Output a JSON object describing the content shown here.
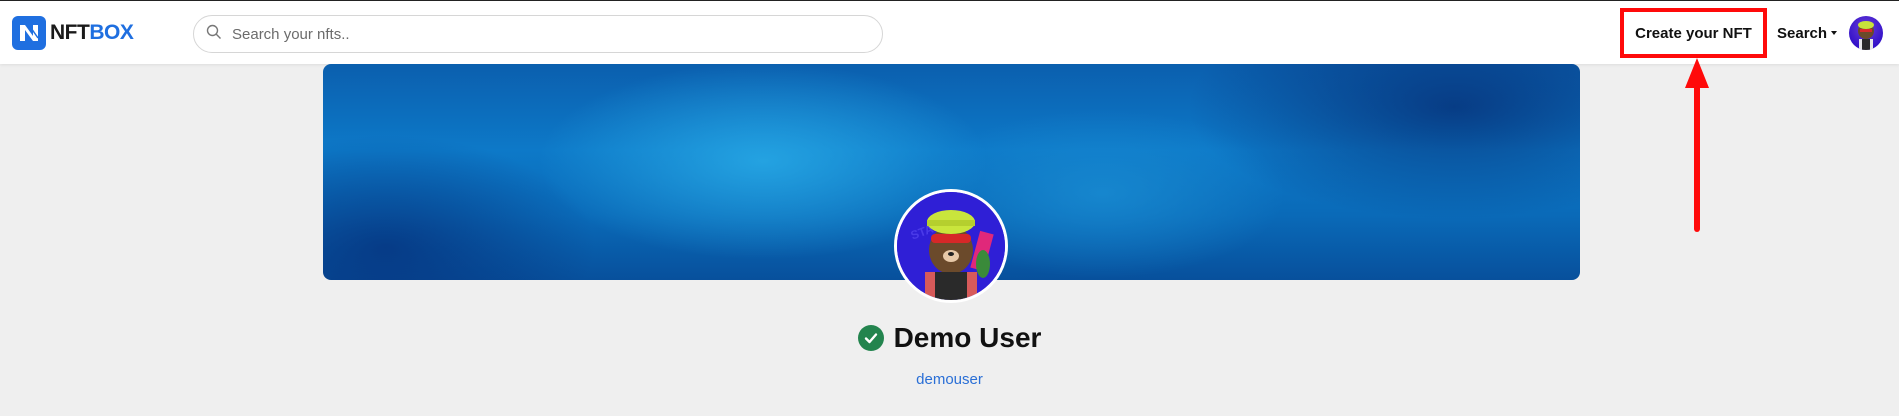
{
  "header": {
    "logo": {
      "part1": "NFT",
      "part2": "BOX"
    },
    "search": {
      "placeholder": "Search your nfts.."
    },
    "create_button": "Create your NFT",
    "search_menu": "Search"
  },
  "profile": {
    "name": "Demo User",
    "username": "demouser",
    "verified": true
  },
  "icons": [
    "logo-mark-icon",
    "search-icon",
    "caret-down-icon",
    "verified-check-icon",
    "annotation-arrow-icon"
  ],
  "colors": {
    "brand": "#1f6fe0",
    "highlight": "#ff0a0a",
    "verified": "#23844e",
    "link": "#2a6fd6"
  }
}
